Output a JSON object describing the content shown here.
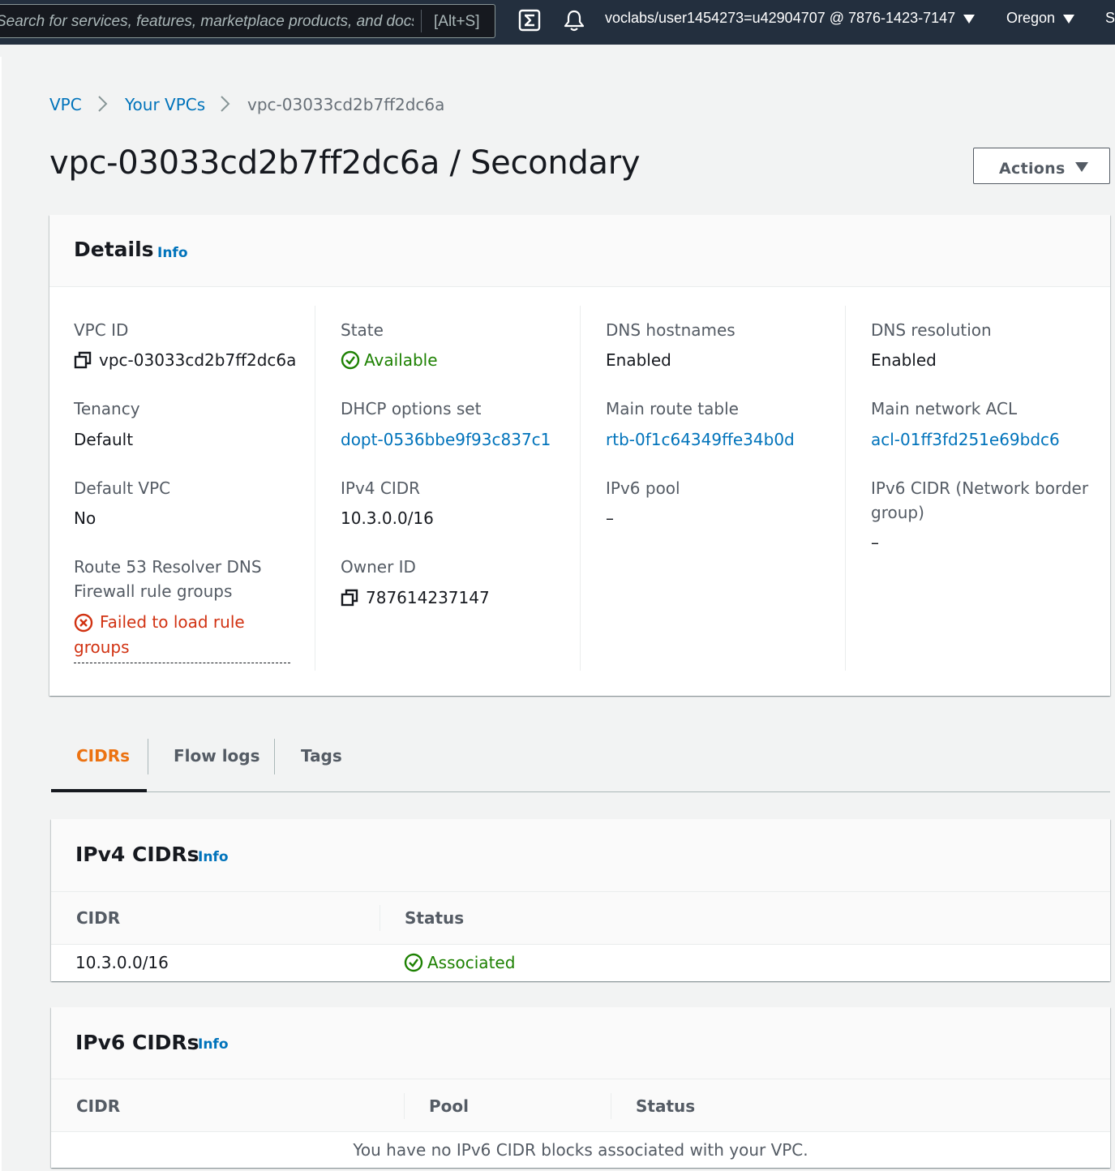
{
  "topnav": {
    "search_placeholder": "Search for services, features, marketplace products, and docs",
    "search_shortcut": "[Alt+S]",
    "account": "voclabs/user1454273=u42904707 @ 7876-1423-7147",
    "region": "Oregon",
    "support_truncated": "S"
  },
  "breadcrumb": {
    "items": [
      "VPC",
      "Your VPCs"
    ],
    "current": "vpc-03033cd2b7ff2dc6a"
  },
  "page": {
    "title": "vpc-03033cd2b7ff2dc6a / Secondary",
    "actions_label": "Actions"
  },
  "details": {
    "title": "Details",
    "info": "Info",
    "vpc_id": {
      "label": "VPC ID",
      "value": "vpc-03033cd2b7ff2dc6a"
    },
    "tenancy": {
      "label": "Tenancy",
      "value": "Default"
    },
    "default_vpc": {
      "label": "Default VPC",
      "value": "No"
    },
    "route53": {
      "label_line1": "Route 53 Resolver DNS",
      "label_line2": "Firewall rule groups",
      "value": "Failed to load rule groups"
    },
    "state": {
      "label": "State",
      "value": "Available"
    },
    "dhcp": {
      "label": "DHCP options set",
      "value": "dopt-0536bbe9f93c837c1"
    },
    "ipv4_cidr": {
      "label": "IPv4 CIDR",
      "value": "10.3.0.0/16"
    },
    "owner_id": {
      "label": "Owner ID",
      "value": "787614237147"
    },
    "dns_hostnames": {
      "label": "DNS hostnames",
      "value": "Enabled"
    },
    "main_route_table": {
      "label": "Main route table",
      "value": "rtb-0f1c64349ffe34b0d"
    },
    "ipv6_pool": {
      "label": "IPv6 pool",
      "value": "–"
    },
    "dns_resolution": {
      "label": "DNS resolution",
      "value": "Enabled"
    },
    "main_network_acl": {
      "label": "Main network ACL",
      "value": "acl-01ff3fd251e69bdc6"
    },
    "ipv6_cidr_nbg": {
      "label_line1": "IPv6 CIDR (Network border",
      "label_line2": "group)",
      "value": "–"
    }
  },
  "tabs": [
    {
      "label": "CIDRs",
      "active": true
    },
    {
      "label": "Flow logs",
      "active": false
    },
    {
      "label": "Tags",
      "active": false
    }
  ],
  "ipv4_cidrs": {
    "title": "IPv4 CIDRs",
    "info": "Info",
    "columns": [
      "CIDR",
      "Status"
    ],
    "rows": [
      {
        "cidr": "10.3.0.0/16",
        "status": "Associated"
      }
    ]
  },
  "ipv6_cidrs": {
    "title": "IPv6 CIDRs",
    "info": "Info",
    "columns": [
      "CIDR",
      "Pool",
      "Status"
    ],
    "empty_message": "You have no IPv6 CIDR blocks associated with your VPC."
  },
  "colors": {
    "nav_bg": "#232f3e",
    "link": "#0073bb",
    "success": "#1d8102",
    "error": "#d13212",
    "tab_active": "#ec7211"
  },
  "icons": [
    "console-shell-icon",
    "notifications-bell-icon",
    "copy-icon",
    "status-success-icon",
    "status-error-icon",
    "chevron-right-icon",
    "caret-down-icon"
  ]
}
